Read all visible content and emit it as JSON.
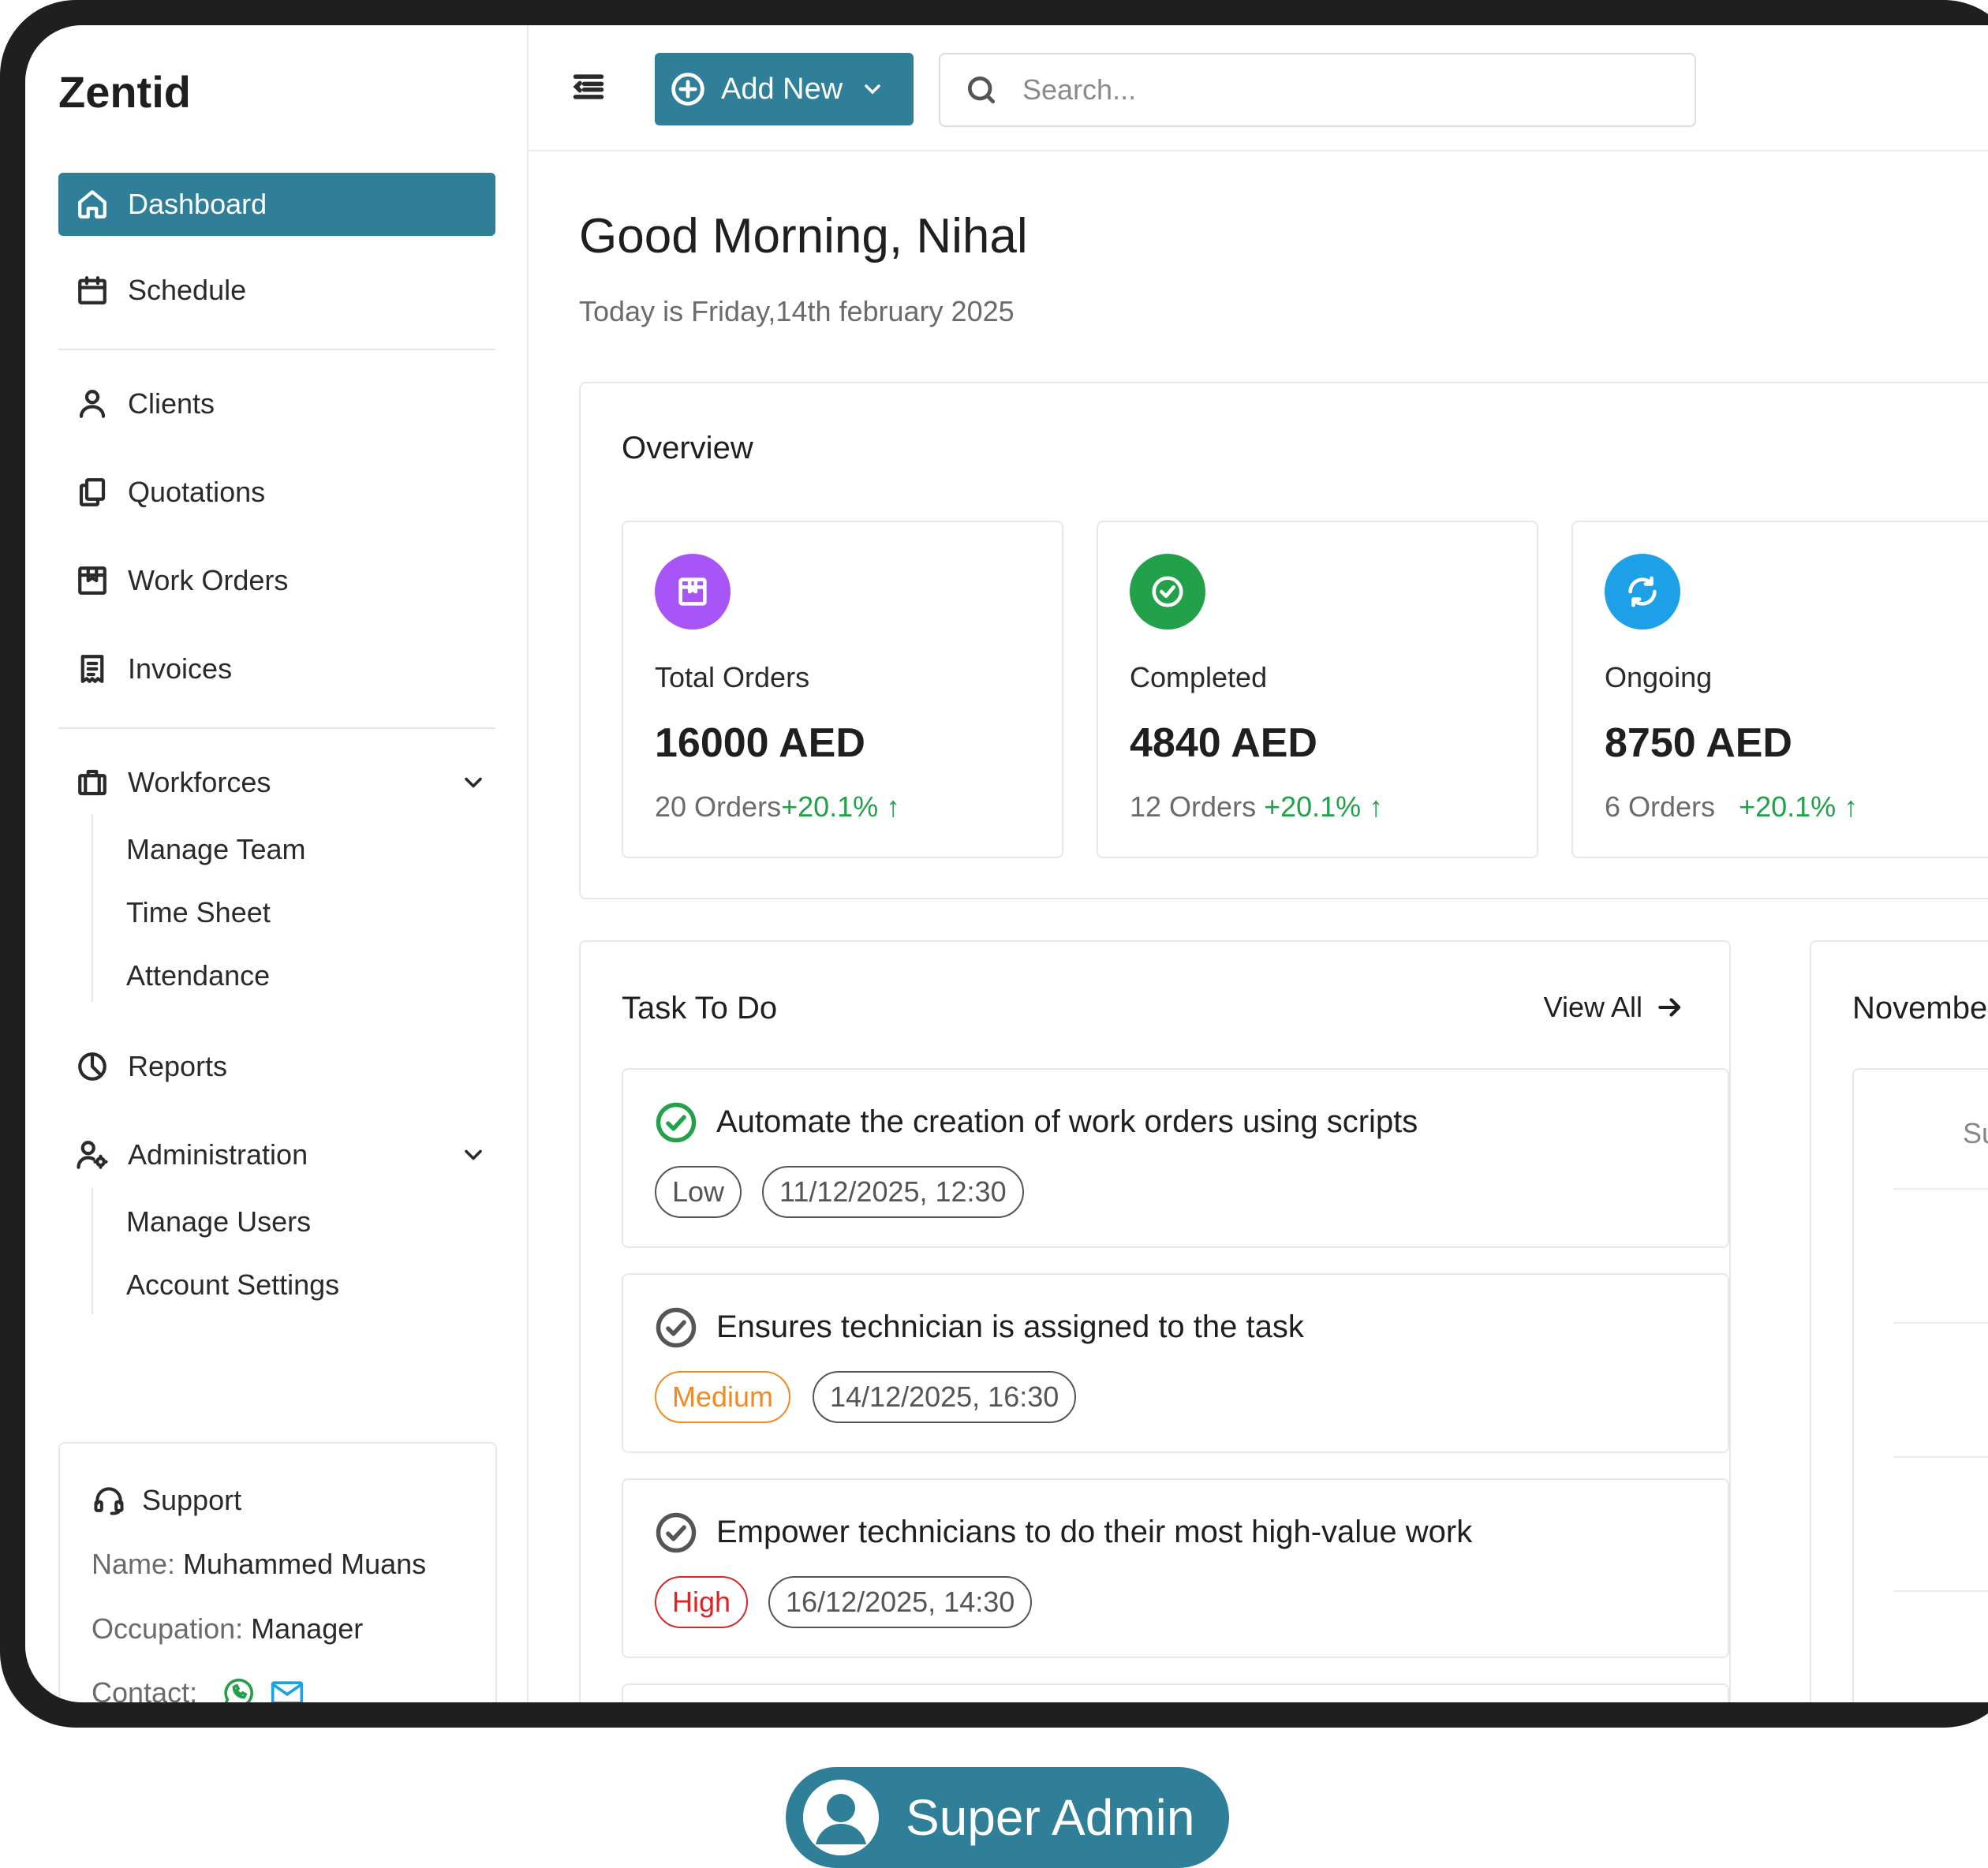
{
  "app": {
    "name": "Zentid"
  },
  "sidebar": {
    "items": [
      {
        "label": "Dashboard",
        "icon": "home-icon",
        "active": true
      },
      {
        "label": "Schedule",
        "icon": "calendar-icon"
      },
      {
        "label": "Clients",
        "icon": "user-icon"
      },
      {
        "label": "Quotations",
        "icon": "documents-icon"
      },
      {
        "label": "Work Orders",
        "icon": "clipboard-icon"
      },
      {
        "label": "Invoices",
        "icon": "invoice-icon"
      },
      {
        "label": "Workforces",
        "icon": "briefcase-icon",
        "expanded": true,
        "children": [
          "Manage Team",
          "Time Sheet",
          "Attendance"
        ]
      },
      {
        "label": "Reports",
        "icon": "pie-chart-icon"
      },
      {
        "label": "Administration",
        "icon": "user-settings-icon",
        "expanded": true,
        "children": [
          "Manage Users",
          "Account Settings"
        ]
      }
    ],
    "support": {
      "title": "Support",
      "name_label": "Name:",
      "name_value": "Muhammed Muans",
      "occupation_label": "Occupation:",
      "occupation_value": "Manager",
      "contact_label": "Contact:",
      "contact_icons": [
        "whatsapp-icon",
        "mail-icon"
      ]
    }
  },
  "topbar": {
    "add_new_label": "Add New",
    "search_placeholder": "Search..."
  },
  "main": {
    "greeting": "Good Morning, Nihal",
    "date_text": "Today is Friday,14th february 2025",
    "overview": {
      "title": "Overview",
      "cards": [
        {
          "label": "Total Orders",
          "value": "16000 AED",
          "orders": "20 Orders",
          "change": "+20.1%",
          "color": "#a855f7",
          "icon": "box-icon"
        },
        {
          "label": "Completed",
          "value": "4840 AED",
          "orders": "12 Orders",
          "change": "+20.1%",
          "color": "#22a04a",
          "icon": "check-circle-icon"
        },
        {
          "label": "Ongoing",
          "value": "8750 AED",
          "orders": "6 Orders",
          "change": "+20.1%",
          "color": "#1ea0e8",
          "icon": "refresh-icon"
        }
      ]
    },
    "tasks": {
      "title": "Task To Do",
      "view_all_label": "View All",
      "items": [
        {
          "title": "Automate the creation of work orders using scripts",
          "priority": "Low",
          "datetime": "11/12/2025, 12:30",
          "done": true
        },
        {
          "title": "Ensures technician is assigned to the task",
          "priority": "Medium",
          "datetime": "14/12/2025, 16:30",
          "done": false
        },
        {
          "title": "Empower technicians to do their most high-value work",
          "priority": "High",
          "datetime": "16/12/2025, 14:30",
          "done": false
        }
      ]
    },
    "calendar": {
      "title": "Novembe",
      "day_label": "Su"
    }
  },
  "role": {
    "label": "Super Admin"
  },
  "colors": {
    "accent": "#2f7f98",
    "positive": "#22a04a",
    "medium": "#f08a24",
    "high": "#d92626"
  }
}
